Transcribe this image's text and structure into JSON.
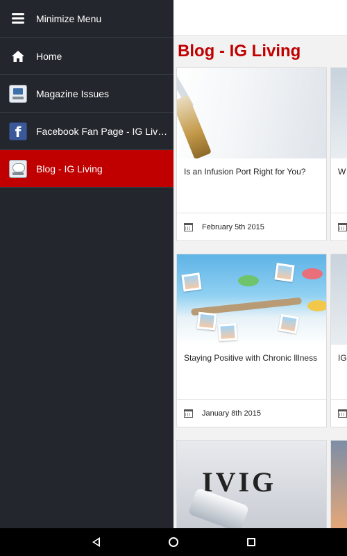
{
  "drawer": {
    "items": [
      {
        "label": "Minimize Menu",
        "icon": "menu-icon"
      },
      {
        "label": "Home",
        "icon": "home-icon"
      },
      {
        "label": "Magazine Issues",
        "icon": "magazine-icon"
      },
      {
        "label": "Facebook Fan Page - IG Living",
        "icon": "facebook-icon"
      },
      {
        "label": "Blog - IG Living",
        "icon": "blog-icon",
        "active": true
      }
    ],
    "active_color": "#c00000",
    "background": "#23272d"
  },
  "main": {
    "page_title": "Blog - IG Living",
    "title_color": "#c00000",
    "posts": [
      {
        "title": "Is an Infusion Port Right for You?",
        "date": "February 5th 2015"
      },
      {
        "title": "Staying Positive with Chronic Illness",
        "date": "January 8th 2015"
      },
      {
        "title": "",
        "date": "",
        "image_text": "IVIG"
      }
    ],
    "peek_posts": [
      {
        "title_fragment": "W"
      },
      {
        "title_fragment": "IG"
      }
    ]
  },
  "navbar": {
    "buttons": [
      "back-icon",
      "home-circle-icon",
      "recents-icon"
    ]
  }
}
